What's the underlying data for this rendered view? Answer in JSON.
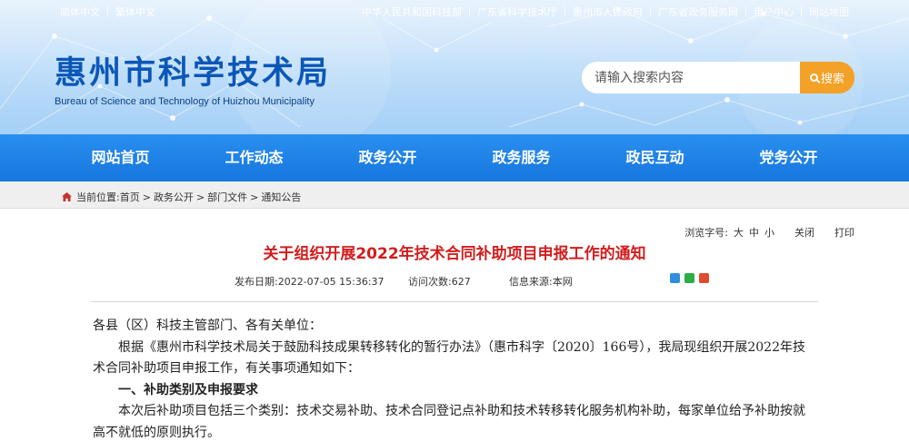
{
  "topbar": {
    "left_links": [
      "简体中文",
      "繁体中文"
    ],
    "right_links": [
      "中华人民共和国科技部",
      "广东省科学技术厅",
      "惠州市人民政府",
      "广东省政务服务网",
      "用户中心",
      "网站地图"
    ]
  },
  "header": {
    "title": "惠州市科学技术局",
    "subtitle": "Bureau of Science and Technology of Huizhou Municipality"
  },
  "search": {
    "placeholder": "请输入搜索内容",
    "button_label": "搜索"
  },
  "nav": {
    "items": [
      "网站首页",
      "工作动态",
      "政务公开",
      "政务服务",
      "政民互动",
      "党务公开"
    ]
  },
  "breadcrumb": {
    "label": "当前位置:",
    "items": [
      "首页",
      "政务公开",
      "部门文件",
      "通知公告"
    ],
    "separator": ">"
  },
  "tools": {
    "font_label": "浏览字号:",
    "sizes": [
      "大",
      "中",
      "小"
    ],
    "close": "关闭",
    "print": "打印"
  },
  "article": {
    "title": "关于组织开展2022年技术合同补助项目申报工作的通知",
    "publish_label": "发布日期:",
    "publish_date": "2022-07-05 15:36:37",
    "views_label": "访问次数:",
    "views": "627",
    "source_label": "信息来源:",
    "source": "本网",
    "paragraphs": [
      "各县（区）科技主管部门、各有关单位：",
      "根据《惠州市科学技术局关于鼓励科技成果转移转化的暂行办法》（惠市科字〔2020〕166号），我局现组织开展2022年技术合同补助项目申报工作，有关事项通知如下：",
      "一、补助类别及申报要求",
      "本次后补助项目包括三个类别：技术交易补助、技术合同登记点补助和技术转移转化服务机构补助，每家单位给予补助按就高不就低的原则执行。"
    ]
  },
  "colors": {
    "nav_bg": "#1a7de4",
    "title_blue": "#0b57b8",
    "search_button": "#f4a127",
    "article_title": "#d11d1d"
  }
}
